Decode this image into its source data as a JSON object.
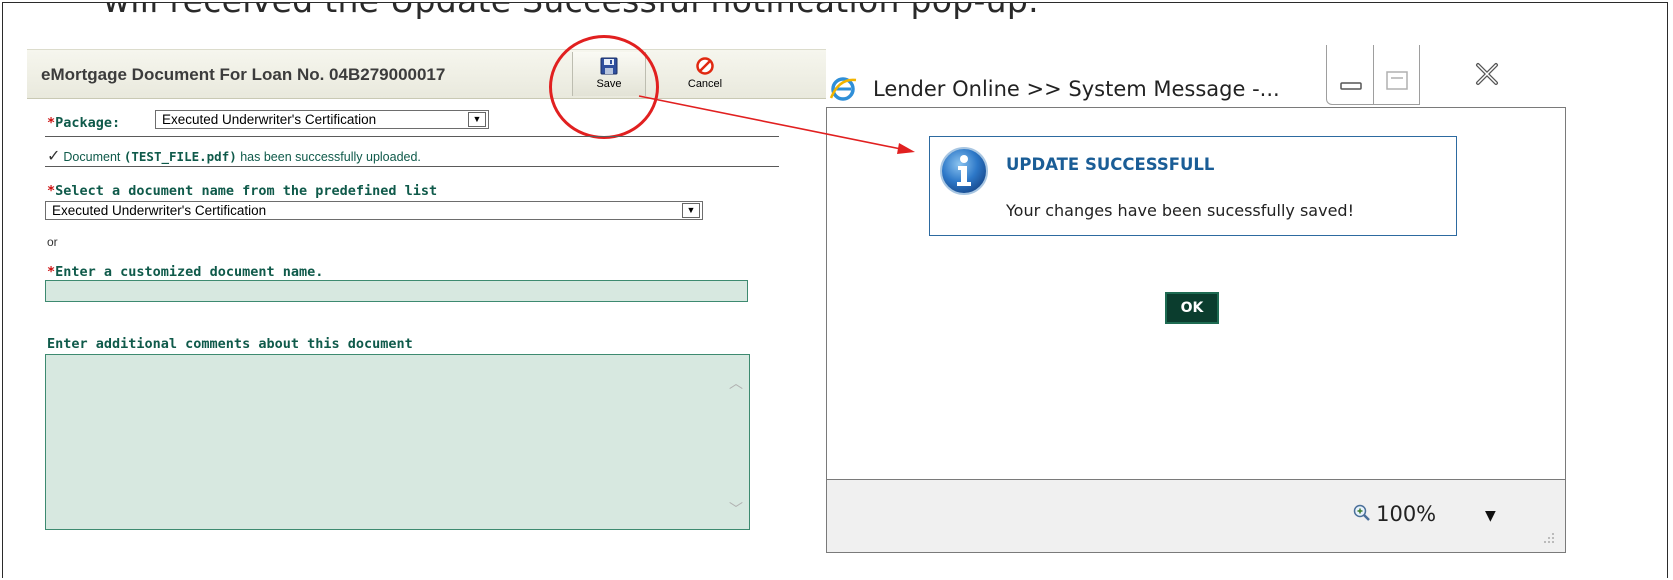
{
  "caption": "will received the Update Successful notification pop-up.",
  "form": {
    "title": "eMortgage Document For Loan No. 04B279000017",
    "toolbar": {
      "save_label": "Save",
      "cancel_label": "Cancel"
    },
    "package": {
      "required_mark": "*",
      "label": "Package:",
      "selected": "Executed Underwriter's Certification"
    },
    "upload": {
      "prefix": "Document ",
      "filename": "(TEST_FILE.pdf)",
      "suffix": " has been successfully uploaded."
    },
    "doc_select": {
      "required_mark": "*",
      "label": "Select a document name from the predefined list",
      "selected": "Executed Underwriter's Certification"
    },
    "or_text": "or",
    "custom_name": {
      "required_mark": "*",
      "label": "Enter a customized document name.",
      "value": ""
    },
    "comments": {
      "label": "Enter additional comments about this document",
      "value": ""
    }
  },
  "popup": {
    "title": "Lender Online >> System Message -...",
    "message_title": "UPDATE SUCCESSFULL",
    "message_text": "Your changes have been sucessfully saved!",
    "ok_label": "OK",
    "zoom": "100%"
  },
  "colors": {
    "accent_green": "#0f5a4a",
    "required_red": "#cc1010",
    "highlight_circle": "#e12020",
    "message_blue": "#1a5d96",
    "ok_button": "#0b3d2e",
    "field_fill": "#d7e8e0"
  },
  "icons": {
    "save": "floppy-disk-icon",
    "cancel": "no-entry-icon",
    "browser": "internet-explorer-icon",
    "info": "info-icon",
    "zoom": "magnifier-plus-icon"
  }
}
